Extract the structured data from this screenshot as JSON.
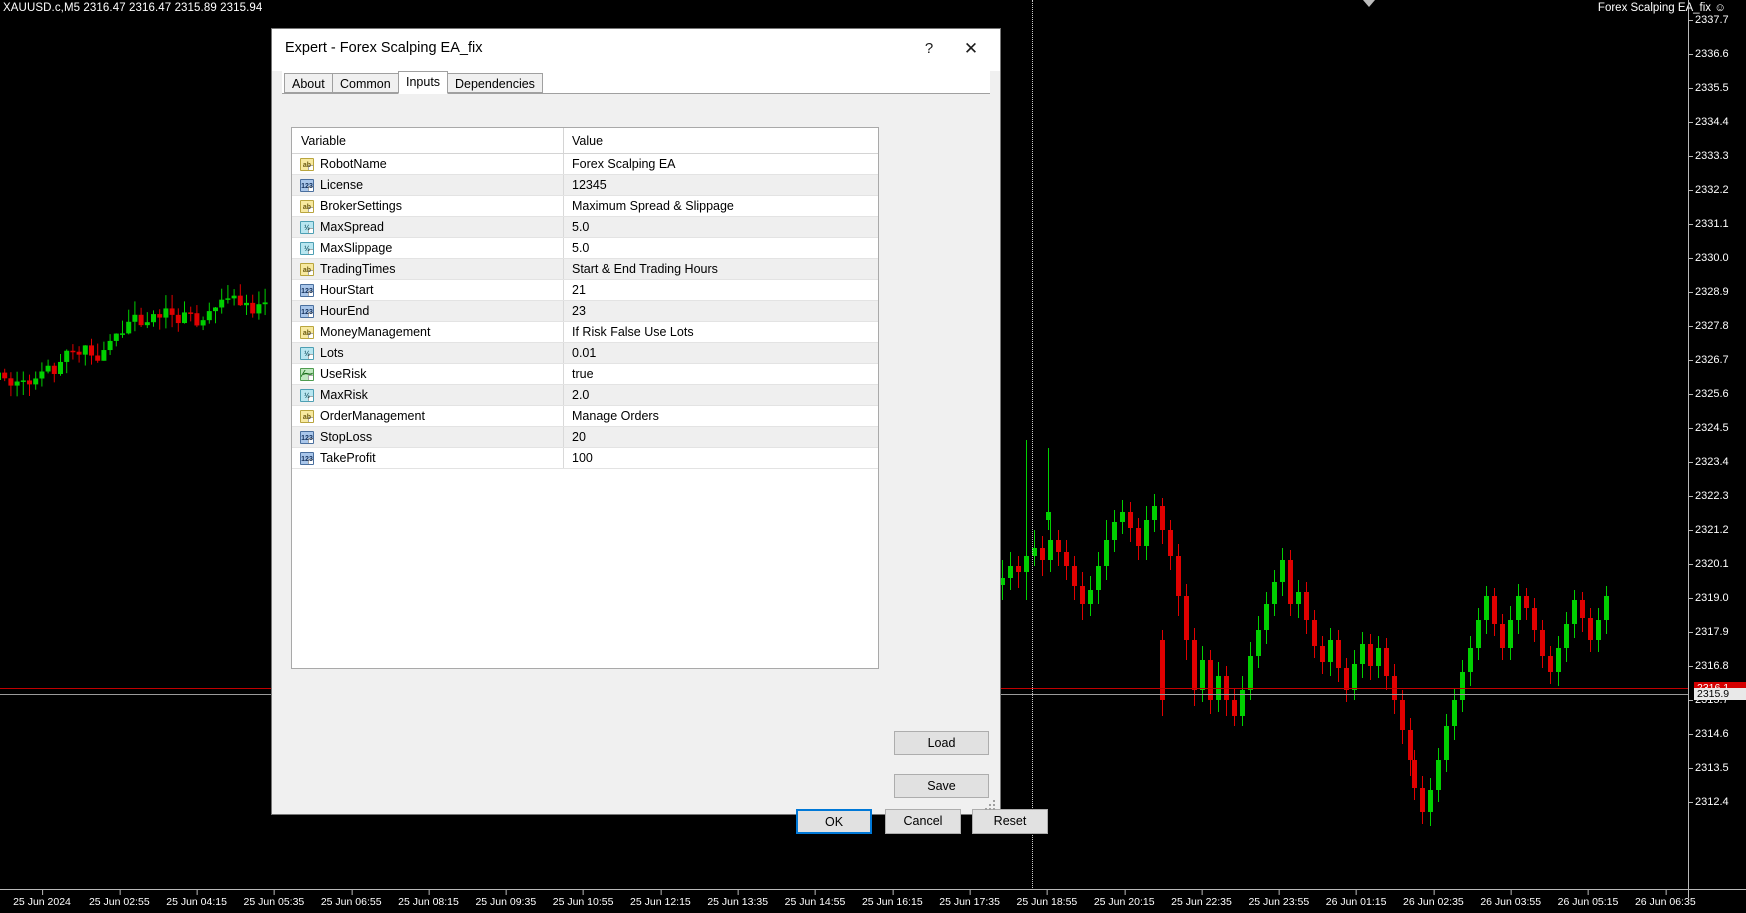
{
  "chart": {
    "quote_bar": "XAUUSD.c,M5  2316.47 2316.47 2315.89 2315.94",
    "ea_label": "Forex Scalping EA_fix ☺",
    "bid_tag": "2316.1",
    "ask_tag": "2315.9",
    "price_ticks": [
      "2337.7",
      "2336.6",
      "2335.5",
      "2334.4",
      "2333.3",
      "2332.2",
      "2331.1",
      "2330.0",
      "2328.9",
      "2327.8",
      "2326.7",
      "2325.6",
      "2324.5",
      "2323.4",
      "2322.3",
      "2321.2",
      "2320.1",
      "2319.0",
      "2317.9",
      "2316.8",
      "2315.7",
      "2314.6",
      "2313.5",
      "2312.4"
    ],
    "time_ticks": [
      "25 Jun 2024",
      "25 Jun 02:55",
      "25 Jun 04:15",
      "25 Jun 05:35",
      "25 Jun 06:55",
      "25 Jun 08:15",
      "25 Jun 09:35",
      "25 Jun 10:55",
      "25 Jun 12:15",
      "25 Jun 13:35",
      "25 Jun 14:55",
      "25 Jun 16:15",
      "25 Jun 17:35",
      "25 Jun 18:55",
      "25 Jun 20:15",
      "25 Jun 22:35",
      "25 Jun 23:55",
      "26 Jun 01:15",
      "26 Jun 02:35",
      "26 Jun 03:55",
      "26 Jun 05:15",
      "26 Jun 06:35"
    ],
    "colors": {
      "bull": "#00d000",
      "bear": "#e00000",
      "bid_line": "#c00000",
      "ask_line": "#9a9a9a",
      "background": "#000000"
    }
  },
  "dialog": {
    "title": "Expert - Forex Scalping EA_fix",
    "help_icon": "?",
    "close_icon": "✕",
    "tabs": [
      {
        "label": "About",
        "active": false
      },
      {
        "label": "Common",
        "active": false
      },
      {
        "label": "Inputs",
        "active": true
      },
      {
        "label": "Dependencies",
        "active": false
      }
    ],
    "table": {
      "headers": {
        "variable": "Variable",
        "value": "Value"
      },
      "rows": [
        {
          "icon": "string-type-icon",
          "glyph": "ab",
          "variable": "RobotName",
          "value": "Forex Scalping EA"
        },
        {
          "icon": "integer-type-icon",
          "glyph": "123",
          "variable": "License",
          "value": "12345"
        },
        {
          "icon": "string-type-icon",
          "glyph": "ab",
          "variable": "BrokerSettings",
          "value": "Maximum Spread & Slippage"
        },
        {
          "icon": "double-type-icon",
          "glyph": "½",
          "variable": "MaxSpread",
          "value": "5.0"
        },
        {
          "icon": "double-type-icon",
          "glyph": "½",
          "variable": "MaxSlippage",
          "value": "5.0"
        },
        {
          "icon": "string-type-icon",
          "glyph": "ab",
          "variable": "TradingTimes",
          "value": "Start & End Trading Hours"
        },
        {
          "icon": "integer-type-icon",
          "glyph": "123",
          "variable": "HourStart",
          "value": "21"
        },
        {
          "icon": "integer-type-icon",
          "glyph": "123",
          "variable": "HourEnd",
          "value": "23"
        },
        {
          "icon": "string-type-icon",
          "glyph": "ab",
          "variable": "MoneyManagement",
          "value": "If Risk False Use Lots"
        },
        {
          "icon": "double-type-icon",
          "glyph": "½",
          "variable": "Lots",
          "value": "0.01"
        },
        {
          "icon": "bool-type-icon",
          "glyph": "⁄⁓",
          "variable": "UseRisk",
          "value": "true"
        },
        {
          "icon": "double-type-icon",
          "glyph": "½",
          "variable": "MaxRisk",
          "value": "2.0"
        },
        {
          "icon": "string-type-icon",
          "glyph": "ab",
          "variable": "OrderManagement",
          "value": "Manage Orders"
        },
        {
          "icon": "integer-type-icon",
          "glyph": "123",
          "variable": "StopLoss",
          "value": "20"
        },
        {
          "icon": "integer-type-icon",
          "glyph": "123",
          "variable": "TakeProfit",
          "value": "100"
        }
      ]
    },
    "buttons": {
      "load": "Load",
      "save": "Save",
      "ok": "OK",
      "cancel": "Cancel",
      "reset": "Reset"
    }
  }
}
